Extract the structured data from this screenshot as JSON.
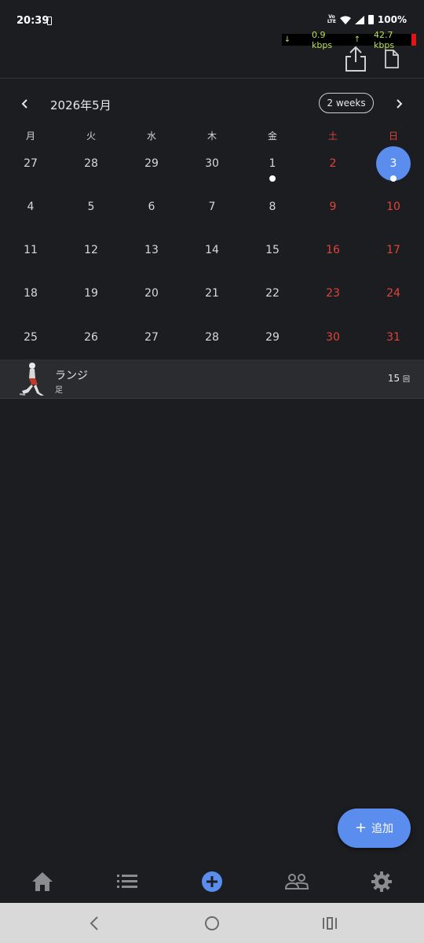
{
  "status_bar": {
    "time": "20:39",
    "network": "LTE",
    "battery": "100%",
    "download_speed": "0.9 kbps",
    "upload_speed": "42.7 kbps"
  },
  "toolbar": {
    "share_icon": "share-icon",
    "document_icon": "document-icon"
  },
  "calendar": {
    "month_title": "2026年5月",
    "view_toggle": "2 weeks",
    "weekdays": [
      "月",
      "火",
      "水",
      "木",
      "金",
      "土",
      "日"
    ],
    "weeks": [
      [
        "27",
        "28",
        "29",
        "30",
        "1",
        "2",
        "3"
      ],
      [
        "4",
        "5",
        "6",
        "7",
        "8",
        "9",
        "10"
      ],
      [
        "11",
        "12",
        "13",
        "14",
        "15",
        "16",
        "17"
      ],
      [
        "18",
        "19",
        "20",
        "21",
        "22",
        "23",
        "24"
      ],
      [
        "25",
        "26",
        "27",
        "28",
        "29",
        "30",
        "31"
      ]
    ],
    "selected_day": "3",
    "days_with_events": [
      "1",
      "3"
    ],
    "accent_color": "#5b8def",
    "weekend_color": "#e0443a"
  },
  "exercise": {
    "name": "ランジ",
    "body_part": "足",
    "count": "15",
    "unit": "回"
  },
  "fab": {
    "label": "追加"
  },
  "bottom_nav": {
    "items": [
      "home-icon",
      "list-icon",
      "add-circle-icon",
      "people-icon",
      "settings-icon"
    ],
    "active": "add-circle-icon"
  }
}
